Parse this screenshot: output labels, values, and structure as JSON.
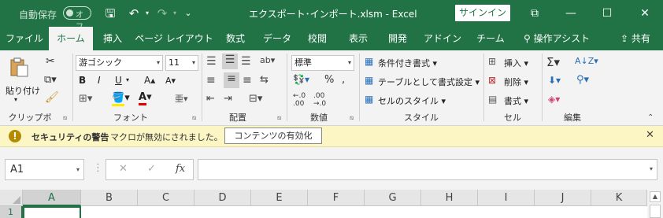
{
  "titlebar": {
    "autosave_label": "自動保存",
    "autosave_state": "オフ",
    "save_glyph": "🖫",
    "undo_glyph": "↶",
    "redo_glyph": "↷",
    "customize_glyph": "⌄",
    "title": "エクスポート･インポート.xlsm  -  Excel",
    "signin": "サインイン",
    "ribbon_display_glyph": "⧉",
    "minimize_glyph": "—",
    "maximize_glyph": "☐",
    "close_glyph": "✕"
  },
  "tabs": [
    "ファイル",
    "ホーム",
    "挿入",
    "ページ レイアウト",
    "数式",
    "データ",
    "校閲",
    "表示",
    "開発",
    "アドイン",
    "チーム"
  ],
  "tell_me": "⚲ 操作アシスト",
  "share": "⇪ 共有",
  "ribbon": {
    "clipboard": {
      "paste": "貼り付け",
      "label": "クリップボード"
    },
    "font": {
      "name": "游ゴシック",
      "size": "11",
      "bold": "B",
      "italic": "I",
      "underline": "U",
      "grow": "A▴",
      "shrink": "A▾",
      "label": "フォント"
    },
    "alignment": {
      "label": "配置"
    },
    "number": {
      "format": "標準",
      "label": "数値"
    },
    "style": {
      "conditional": "条件付き書式 ▾",
      "as_table": "テーブルとして書式設定 ▾",
      "cell_style": "セルのスタイル ▾",
      "label": "スタイル"
    },
    "cells": {
      "insert": "挿入 ▾",
      "delete": "削除 ▾",
      "format": "書式 ▾",
      "label": "セル"
    },
    "editing": {
      "label": "編集"
    }
  },
  "security_bar": {
    "title": "セキュリティの警告",
    "message": "マクロが無効にされました。",
    "button": "コンテンツの有効化"
  },
  "formula_bar": {
    "name_box": "A1",
    "cancel": "✕",
    "enter": "✓",
    "fx": "fx",
    "content": ""
  },
  "grid": {
    "columns": [
      "A",
      "B",
      "C",
      "D",
      "E",
      "F",
      "G",
      "H",
      "I",
      "J",
      "K"
    ],
    "rows": [
      "1"
    ],
    "selected_cell": "A1"
  },
  "colors": {
    "accent": "#217346",
    "security_bar": "#fcf6c4"
  }
}
